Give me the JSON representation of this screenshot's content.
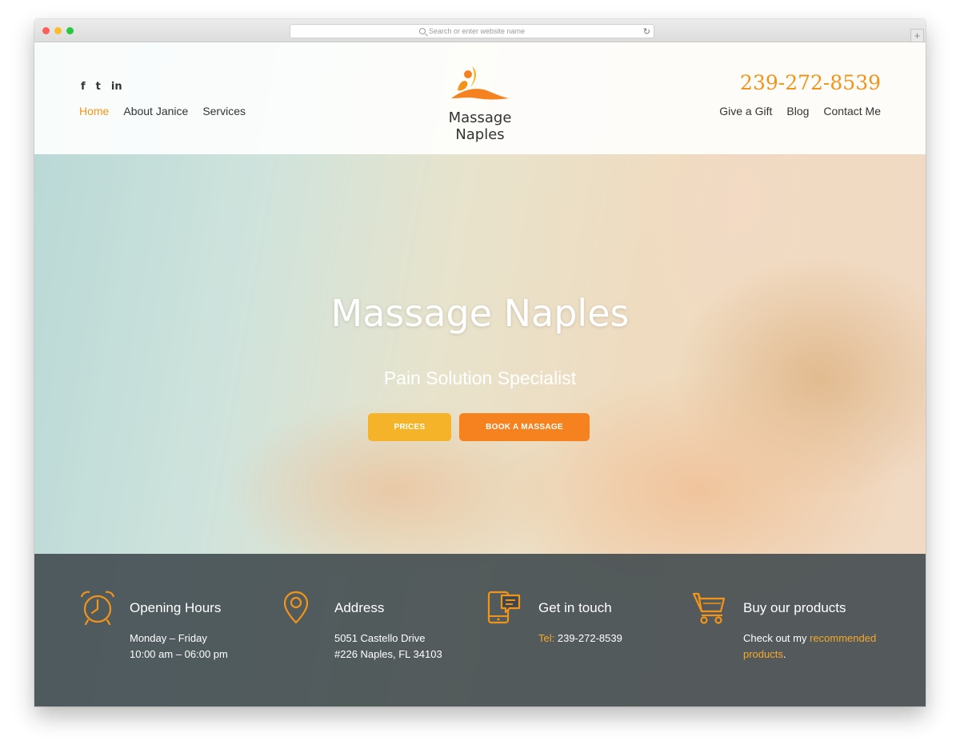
{
  "browser": {
    "url_placeholder": "Search or enter website name"
  },
  "header": {
    "phone": "239-272-8539",
    "logo_text": "Massage Naples",
    "nav_left": [
      "Home",
      "About Janice",
      "Services"
    ],
    "nav_right": [
      "Give a Gift",
      "Blog",
      "Contact Me"
    ],
    "social": [
      "f",
      "t",
      "in"
    ]
  },
  "hero": {
    "title": "Massage Naples",
    "subtitle": "Pain Solution Specialist",
    "btn_prices": "PRICES",
    "btn_book": "BOOK A MASSAGE"
  },
  "info": {
    "hours_title": "Opening Hours",
    "hours_line1": "Monday – Friday",
    "hours_line2": "10:00 am – 06:00 pm",
    "address_title": "Address",
    "address_line1": "5051 Castello Drive",
    "address_line2": "#226 Naples, FL 34103",
    "contact_title": "Get in touch",
    "contact_label": "Tel:",
    "contact_phone": "239-272-8539",
    "products_title": "Buy our products",
    "products_pre": "Check out my",
    "products_link": "recommended products",
    "products_post": "."
  },
  "colors": {
    "accent": "#f29419",
    "prices_button": "#f4b328",
    "book_button": "#f6821f",
    "info_bar": "#3e484c"
  },
  "icons": [
    "facebook-icon",
    "twitter-icon",
    "linkedin-icon",
    "alarm-clock-icon",
    "location-pin-icon",
    "phone-chat-icon",
    "shopping-cart-icon"
  ]
}
